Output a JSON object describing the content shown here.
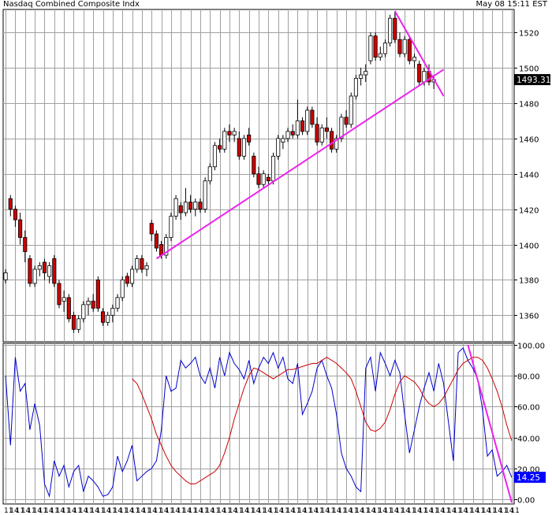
{
  "header": {
    "title": "Nasdaq Combined Composite Indx",
    "timestamp": "May 08 15:11 EST"
  },
  "chart_data": [
    {
      "type": "candlestick",
      "title": "Nasdaq Combined Composite Indx",
      "y_ticks": [
        1360,
        1380,
        1400,
        1420,
        1440,
        1460,
        1480,
        1500,
        1520
      ],
      "ylim": [
        1345,
        1533
      ],
      "grid": true,
      "last_value_label": "1493.31",
      "colors": {
        "up": "#ffffff",
        "down": "#cc0000",
        "wick": "#000000",
        "trendline": "#ee22ee",
        "last_label_bg": "#000000"
      },
      "candles": [
        {
          "o": 1380,
          "h": 1386,
          "l": 1378,
          "c": 1384
        },
        {
          "o": 1426,
          "h": 1428,
          "l": 1416,
          "c": 1420
        },
        {
          "o": 1420,
          "h": 1422,
          "l": 1410,
          "c": 1414
        },
        {
          "o": 1414,
          "h": 1418,
          "l": 1400,
          "c": 1404
        },
        {
          "o": 1404,
          "h": 1408,
          "l": 1390,
          "c": 1396
        },
        {
          "o": 1392,
          "h": 1394,
          "l": 1376,
          "c": 1378
        },
        {
          "o": 1378,
          "h": 1388,
          "l": 1376,
          "c": 1386
        },
        {
          "o": 1386,
          "h": 1390,
          "l": 1382,
          "c": 1388
        },
        {
          "o": 1390,
          "h": 1392,
          "l": 1380,
          "c": 1384
        },
        {
          "o": 1382,
          "h": 1390,
          "l": 1378,
          "c": 1388
        },
        {
          "o": 1392,
          "h": 1394,
          "l": 1376,
          "c": 1378
        },
        {
          "o": 1378,
          "h": 1380,
          "l": 1364,
          "c": 1366
        },
        {
          "o": 1368,
          "h": 1374,
          "l": 1362,
          "c": 1370
        },
        {
          "o": 1370,
          "h": 1372,
          "l": 1356,
          "c": 1358
        },
        {
          "o": 1360,
          "h": 1362,
          "l": 1350,
          "c": 1352
        },
        {
          "o": 1352,
          "h": 1360,
          "l": 1350,
          "c": 1358
        },
        {
          "o": 1358,
          "h": 1368,
          "l": 1356,
          "c": 1366
        },
        {
          "o": 1366,
          "h": 1370,
          "l": 1360,
          "c": 1368
        },
        {
          "o": 1368,
          "h": 1372,
          "l": 1362,
          "c": 1364
        },
        {
          "o": 1380,
          "h": 1382,
          "l": 1362,
          "c": 1364
        },
        {
          "o": 1362,
          "h": 1364,
          "l": 1354,
          "c": 1356
        },
        {
          "o": 1356,
          "h": 1362,
          "l": 1354,
          "c": 1360
        },
        {
          "o": 1360,
          "h": 1366,
          "l": 1356,
          "c": 1364
        },
        {
          "o": 1364,
          "h": 1372,
          "l": 1362,
          "c": 1370
        },
        {
          "o": 1370,
          "h": 1382,
          "l": 1368,
          "c": 1380
        },
        {
          "o": 1382,
          "h": 1384,
          "l": 1376,
          "c": 1378
        },
        {
          "o": 1378,
          "h": 1388,
          "l": 1376,
          "c": 1386
        },
        {
          "o": 1386,
          "h": 1394,
          "l": 1384,
          "c": 1392
        },
        {
          "o": 1392,
          "h": 1394,
          "l": 1384,
          "c": 1386
        },
        {
          "o": 1386,
          "h": 1390,
          "l": 1382,
          "c": 1388
        },
        {
          "o": 1412,
          "h": 1414,
          "l": 1402,
          "c": 1406
        },
        {
          "o": 1406,
          "h": 1408,
          "l": 1396,
          "c": 1398
        },
        {
          "o": 1400,
          "h": 1402,
          "l": 1392,
          "c": 1394
        },
        {
          "o": 1394,
          "h": 1406,
          "l": 1392,
          "c": 1404
        },
        {
          "o": 1404,
          "h": 1418,
          "l": 1402,
          "c": 1416
        },
        {
          "o": 1416,
          "h": 1428,
          "l": 1414,
          "c": 1426
        },
        {
          "o": 1422,
          "h": 1424,
          "l": 1414,
          "c": 1418
        },
        {
          "o": 1418,
          "h": 1432,
          "l": 1416,
          "c": 1424
        },
        {
          "o": 1424,
          "h": 1428,
          "l": 1418,
          "c": 1420
        },
        {
          "o": 1420,
          "h": 1426,
          "l": 1416,
          "c": 1424
        },
        {
          "o": 1424,
          "h": 1426,
          "l": 1418,
          "c": 1420
        },
        {
          "o": 1420,
          "h": 1438,
          "l": 1418,
          "c": 1436
        },
        {
          "o": 1436,
          "h": 1446,
          "l": 1434,
          "c": 1444
        },
        {
          "o": 1444,
          "h": 1458,
          "l": 1442,
          "c": 1456
        },
        {
          "o": 1456,
          "h": 1460,
          "l": 1452,
          "c": 1454
        },
        {
          "o": 1454,
          "h": 1466,
          "l": 1452,
          "c": 1464
        },
        {
          "o": 1464,
          "h": 1468,
          "l": 1458,
          "c": 1462
        },
        {
          "o": 1462,
          "h": 1466,
          "l": 1458,
          "c": 1464
        },
        {
          "o": 1460,
          "h": 1464,
          "l": 1448,
          "c": 1450
        },
        {
          "o": 1450,
          "h": 1462,
          "l": 1448,
          "c": 1460
        },
        {
          "o": 1462,
          "h": 1466,
          "l": 1456,
          "c": 1458
        },
        {
          "o": 1450,
          "h": 1452,
          "l": 1438,
          "c": 1440
        },
        {
          "o": 1440,
          "h": 1444,
          "l": 1432,
          "c": 1434
        },
        {
          "o": 1434,
          "h": 1442,
          "l": 1432,
          "c": 1440
        },
        {
          "o": 1438,
          "h": 1440,
          "l": 1434,
          "c": 1436
        },
        {
          "o": 1436,
          "h": 1452,
          "l": 1434,
          "c": 1450
        },
        {
          "o": 1450,
          "h": 1462,
          "l": 1448,
          "c": 1460
        },
        {
          "o": 1458,
          "h": 1462,
          "l": 1454,
          "c": 1460
        },
        {
          "o": 1460,
          "h": 1466,
          "l": 1458,
          "c": 1464
        },
        {
          "o": 1464,
          "h": 1468,
          "l": 1460,
          "c": 1462
        },
        {
          "o": 1462,
          "h": 1482,
          "l": 1460,
          "c": 1470
        },
        {
          "o": 1470,
          "h": 1472,
          "l": 1462,
          "c": 1464
        },
        {
          "o": 1464,
          "h": 1478,
          "l": 1462,
          "c": 1476
        },
        {
          "o": 1476,
          "h": 1478,
          "l": 1466,
          "c": 1468
        },
        {
          "o": 1468,
          "h": 1472,
          "l": 1456,
          "c": 1458
        },
        {
          "o": 1458,
          "h": 1468,
          "l": 1456,
          "c": 1466
        },
        {
          "o": 1466,
          "h": 1472,
          "l": 1460,
          "c": 1464
        },
        {
          "o": 1464,
          "h": 1466,
          "l": 1452,
          "c": 1454
        },
        {
          "o": 1454,
          "h": 1462,
          "l": 1452,
          "c": 1460
        },
        {
          "o": 1460,
          "h": 1474,
          "l": 1458,
          "c": 1472
        },
        {
          "o": 1472,
          "h": 1476,
          "l": 1466,
          "c": 1468
        },
        {
          "o": 1468,
          "h": 1486,
          "l": 1466,
          "c": 1484
        },
        {
          "o": 1484,
          "h": 1496,
          "l": 1482,
          "c": 1494
        },
        {
          "o": 1494,
          "h": 1500,
          "l": 1490,
          "c": 1496
        },
        {
          "o": 1496,
          "h": 1502,
          "l": 1492,
          "c": 1498
        },
        {
          "o": 1504,
          "h": 1520,
          "l": 1502,
          "c": 1518
        },
        {
          "o": 1518,
          "h": 1520,
          "l": 1504,
          "c": 1506
        },
        {
          "o": 1506,
          "h": 1512,
          "l": 1504,
          "c": 1508
        },
        {
          "o": 1508,
          "h": 1516,
          "l": 1506,
          "c": 1514
        },
        {
          "o": 1514,
          "h": 1530,
          "l": 1512,
          "c": 1528
        },
        {
          "o": 1528,
          "h": 1532,
          "l": 1514,
          "c": 1516
        },
        {
          "o": 1516,
          "h": 1520,
          "l": 1506,
          "c": 1508
        },
        {
          "o": 1508,
          "h": 1518,
          "l": 1506,
          "c": 1516
        },
        {
          "o": 1516,
          "h": 1518,
          "l": 1502,
          "c": 1504
        },
        {
          "o": 1504,
          "h": 1508,
          "l": 1500,
          "c": 1506
        },
        {
          "o": 1502,
          "h": 1504,
          "l": 1490,
          "c": 1492
        },
        {
          "o": 1492,
          "h": 1500,
          "l": 1490,
          "c": 1498
        },
        {
          "o": 1498,
          "h": 1502,
          "l": 1490,
          "c": 1492
        },
        {
          "o": 1492,
          "h": 1496,
          "l": 1488,
          "c": 1493.31
        }
      ],
      "trendlines": [
        {
          "from": [
            31,
            1392
          ],
          "to": [
            90,
            1499
          ]
        },
        {
          "from": [
            80,
            1532
          ],
          "to": [
            90,
            1484
          ]
        }
      ]
    },
    {
      "type": "line",
      "y_ticks": [
        0,
        20,
        40,
        60,
        80,
        100
      ],
      "y_tick_labels": [
        "0.00",
        "20.00",
        "40.00",
        "60.00",
        "80.00",
        "100.00"
      ],
      "ylim": [
        -3,
        101
      ],
      "grid": true,
      "last_value_label": "14.25",
      "x_tick_labels": [
        "11",
        "14",
        "11",
        "14",
        "11",
        "14",
        "11",
        "14",
        "11",
        "14",
        "11",
        "14",
        "11",
        "14",
        "11",
        "14",
        "11",
        "14",
        "11",
        "14",
        "11",
        "14",
        "11",
        "14",
        "11",
        "14",
        "11",
        "14",
        "11",
        "14",
        "11",
        "14",
        "11",
        "14",
        "11",
        "14",
        "11",
        "14",
        "11",
        "14",
        "11",
        "14",
        "11",
        "14",
        "11",
        "14",
        "11",
        "14",
        "11",
        "14",
        "11",
        "14",
        "11",
        "14",
        "11",
        "14",
        "11",
        "14",
        "11",
        "14",
        "11",
        "14",
        "11",
        "14",
        "11",
        "14",
        "11",
        "14",
        "11",
        "14",
        "11",
        "14",
        "11",
        "14",
        "11",
        "14",
        "11",
        "14",
        "11",
        "14",
        "11",
        "14",
        "11",
        "14",
        "11",
        "14",
        "11",
        "14",
        "11"
      ],
      "colors": {
        "fast": "#0000cc",
        "slow": "#cc0000",
        "trendline": "#ee22ee",
        "last_label_bg": "#0000ff"
      },
      "series": [
        {
          "values": [
            80,
            35,
            92,
            70,
            75,
            45,
            62,
            48,
            10,
            2,
            25,
            15,
            22,
            8,
            18,
            22,
            5,
            15,
            12,
            8,
            2,
            3,
            8,
            28,
            18,
            25,
            35,
            12,
            15,
            18,
            20,
            25,
            45,
            80,
            70,
            72,
            90,
            85,
            88,
            92,
            80,
            75,
            85,
            72,
            92,
            80,
            95,
            88,
            84,
            78,
            90,
            75,
            85,
            92,
            88,
            95,
            85,
            92,
            78,
            75,
            88,
            55,
            62,
            70,
            85,
            90,
            80,
            72,
            55,
            30,
            20,
            15,
            8,
            5,
            85,
            92,
            70,
            95,
            88,
            80,
            90,
            82,
            55,
            30,
            45,
            60,
            72,
            82,
            70,
            88,
            75,
            50,
            25,
            95,
            98,
            90,
            85,
            78,
            58,
            28,
            32,
            15,
            18,
            22,
            14.25
          ]
        },
        {
          "values": [
            78,
            75,
            68,
            60,
            52,
            42,
            35,
            28,
            22,
            18,
            15,
            12,
            10,
            10,
            12,
            14,
            16,
            18,
            22,
            30,
            40,
            52,
            62,
            72,
            80,
            85,
            84,
            82,
            80,
            78,
            80,
            82,
            84,
            84,
            85,
            86,
            87,
            88,
            88,
            90,
            92,
            90,
            88,
            85,
            82,
            78,
            70,
            60,
            50,
            45,
            44,
            46,
            50,
            58,
            68,
            76,
            80,
            78,
            76,
            72,
            66,
            62,
            60,
            62,
            66,
            72,
            78,
            84,
            88,
            90,
            92,
            92,
            90,
            85,
            78,
            70,
            60,
            48,
            38
          ]
        }
      ],
      "trendlines": [
        {
          "from": [
            95,
            100
          ],
          "to": [
            104,
            -2
          ]
        }
      ]
    }
  ]
}
